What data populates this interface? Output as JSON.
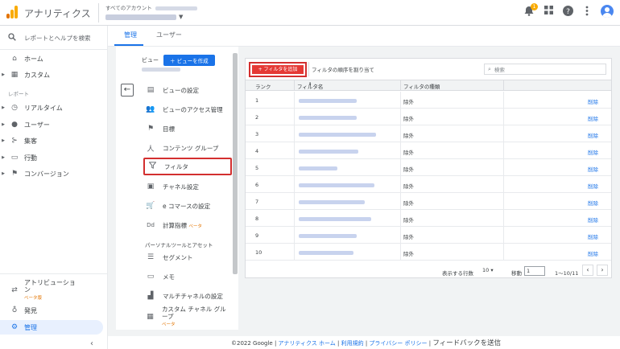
{
  "app": {
    "title": "アナリティクス",
    "account_label": "すべてのアカウント",
    "bell_count": "1"
  },
  "sidebar": {
    "search_label": "レポートとヘルプを検索",
    "home": "ホーム",
    "custom": "カスタム",
    "section_reports": "レポート",
    "items": [
      {
        "label": "リアルタイム",
        "icon": "clock-icon"
      },
      {
        "label": "ユーザー",
        "icon": "person-icon"
      },
      {
        "label": "集客",
        "icon": "acquisition-icon"
      },
      {
        "label": "行動",
        "icon": "behavior-icon"
      },
      {
        "label": "コンバージョン",
        "icon": "flag-icon"
      }
    ],
    "attribution_line1": "アトリビューショ",
    "attribution_line2": "ン",
    "attribution_beta": "ベータ版",
    "discover": "発見",
    "admin": "管理"
  },
  "tabs": [
    "管理",
    "ユーザー"
  ],
  "view": {
    "label": "ビュー",
    "create_button": "ビューを作成"
  },
  "menu": {
    "items": [
      "ビューの設定",
      "ビューのアクセス管理",
      "目標",
      "コンテンツ グループ",
      "フィルタ",
      "チャネル設定",
      "e コマースの設定",
      "計算指標"
    ],
    "calc_beta": "ベータ",
    "section_personal": "パーソナルツールとアセット",
    "personal": [
      "セグメント",
      "メモ",
      "マルチチャネルの設定"
    ],
    "custom_channel_group": "カスタム チャネル グループ",
    "custom_channel_beta": "ベータ"
  },
  "filters": {
    "add_button": "+ フィルタを追加",
    "reorder_label": "フィルタの順序を割り当て",
    "search_placeholder": "検索",
    "columns": [
      "ランク",
      "フィルタ名",
      "フィルタの種類"
    ],
    "rows": [
      {
        "rank": "1",
        "type": "除外",
        "action": "削除"
      },
      {
        "rank": "2",
        "type": "除外",
        "action": "削除"
      },
      {
        "rank": "3",
        "type": "除外",
        "action": "削除"
      },
      {
        "rank": "4",
        "type": "除外",
        "action": "削除"
      },
      {
        "rank": "5",
        "type": "除外",
        "action": "削除"
      },
      {
        "rank": "6",
        "type": "除外",
        "action": "削除"
      },
      {
        "rank": "7",
        "type": "除外",
        "action": "削除"
      },
      {
        "rank": "8",
        "type": "除外",
        "action": "削除"
      },
      {
        "rank": "9",
        "type": "除外",
        "action": "削除"
      },
      {
        "rank": "10",
        "type": "除外",
        "action": "削除"
      }
    ],
    "pager": {
      "rows_label": "表示する行数",
      "rows_value": "10",
      "goto_label": "移動",
      "goto_value": "1",
      "range": "1～10/11"
    }
  },
  "footer": {
    "copyright": "©2022 Google",
    "links": [
      "アナリティクス ホーム",
      "利用規約",
      "プライバシー ポリシー"
    ],
    "feedback": "フィードバックを送信"
  },
  "colors": {
    "accent": "#1a73e8",
    "highlight_border": "#d32f2f",
    "add_button": "#e53935",
    "logo_orange": "#f9ab00",
    "logo_dark": "#e37400"
  }
}
